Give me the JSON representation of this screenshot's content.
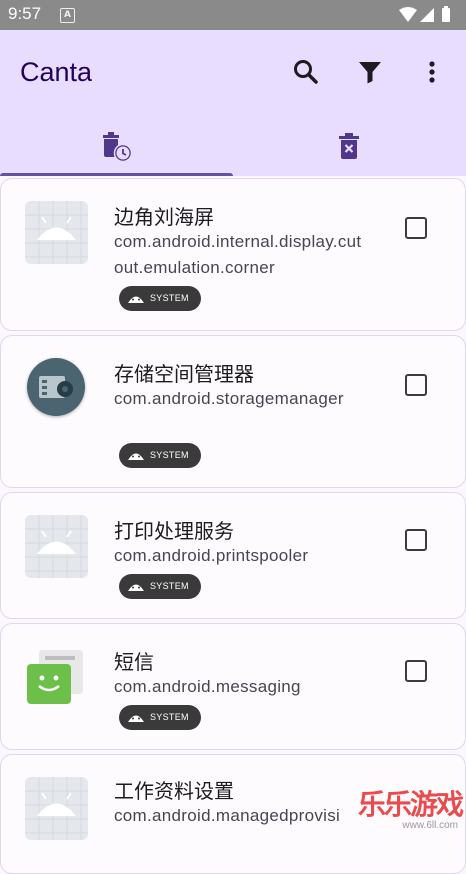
{
  "statusbar": {
    "time": "9:57",
    "badge": "A"
  },
  "appbar": {
    "title": "Canta",
    "actions": [
      "search-icon",
      "filter-icon",
      "more-vert-icon"
    ]
  },
  "tabs": [
    {
      "name": "uninstalled-history",
      "icon": "delete-clock-icon",
      "selected": true
    },
    {
      "name": "uninstall",
      "icon": "delete-x-icon",
      "selected": false
    }
  ],
  "colors": {
    "appbar": "#e9ddff",
    "primary": "#6750a4",
    "chip": "#3a3a3a"
  },
  "apps": [
    {
      "name": "边角刘海屏",
      "package": "com.android.internal.display.cutout.emulation.corner",
      "tag": "SYSTEM",
      "icon": "android-placeholder-icon",
      "checked": false
    },
    {
      "name": "存储空间管理器",
      "package": "com.android.storagemanager",
      "tag": "SYSTEM",
      "icon": "storage-manager-icon",
      "checked": false
    },
    {
      "name": "打印处理服务",
      "package": "com.android.printspooler",
      "tag": "SYSTEM",
      "icon": "android-placeholder-icon",
      "checked": false
    },
    {
      "name": "短信",
      "package": "com.android.messaging",
      "tag": "SYSTEM",
      "icon": "messaging-icon",
      "checked": false
    },
    {
      "name": "工作资料设置",
      "package": "com.android.managedprovisi",
      "tag": "",
      "icon": "android-placeholder-icon",
      "checked": false
    }
  ],
  "watermark": {
    "text": "乐乐游戏",
    "subtext": "www.6ll.com"
  }
}
